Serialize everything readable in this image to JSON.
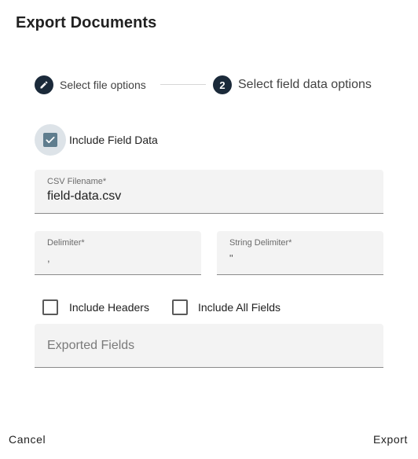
{
  "dialog": {
    "title": "Export Documents"
  },
  "stepper": {
    "steps": [
      {
        "label": "Select file options",
        "icon": "pencil-icon",
        "state": "completed"
      },
      {
        "number": "2",
        "label": "Select field data options",
        "state": "active"
      }
    ],
    "step_color": "#1b2a3a"
  },
  "form": {
    "include_field_data": {
      "label": "Include Field Data",
      "checked": true
    },
    "csv_filename": {
      "label": "CSV Filename*",
      "value": "field-data.csv"
    },
    "delimiter": {
      "label": "Delimiter*",
      "value": ","
    },
    "string_delimiter": {
      "label": "String Delimiter*",
      "value": "\""
    },
    "include_headers": {
      "label": "Include Headers",
      "checked": false
    },
    "include_all_fields": {
      "label": "Include All Fields",
      "checked": false
    },
    "exported_fields": {
      "placeholder": "Exported Fields",
      "value": ""
    }
  },
  "actions": {
    "cancel_label": "Cancel",
    "export_label": "Export"
  },
  "colors": {
    "checkbox_checked": "#5f7d8e",
    "field_background": "#f3f3f3"
  }
}
